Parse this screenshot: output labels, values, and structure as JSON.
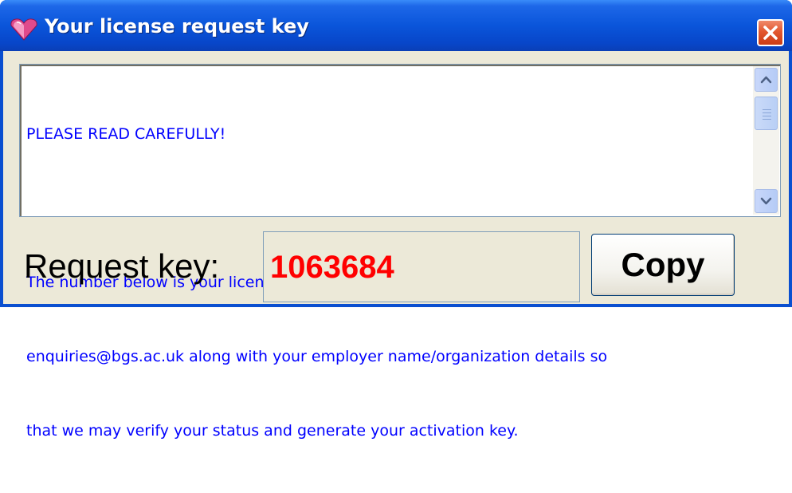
{
  "window": {
    "title": "Your license request key"
  },
  "message": {
    "lines": [
      "PLEASE READ CAREFULLY!",
      "",
      "The number below is your license request key. Please send this key to",
      "enquiries@bgs.ac.uk along with your employer name/organization details so",
      "that we may verify your status and generate your activation key."
    ]
  },
  "request": {
    "label": "Request key:",
    "value": "1063684",
    "value_color": "#ff0000"
  },
  "copy_button": {
    "label": "Copy"
  },
  "icons": {
    "app": "heart-gem-icon",
    "close": "close-icon",
    "scroll_up": "arrow-up-icon",
    "scroll_down": "arrow-down-icon"
  },
  "colors": {
    "titlebar": "#0a55da",
    "client_bg": "#ece9d8",
    "message_text": "#0000ff",
    "close_button": "#e2572f"
  }
}
